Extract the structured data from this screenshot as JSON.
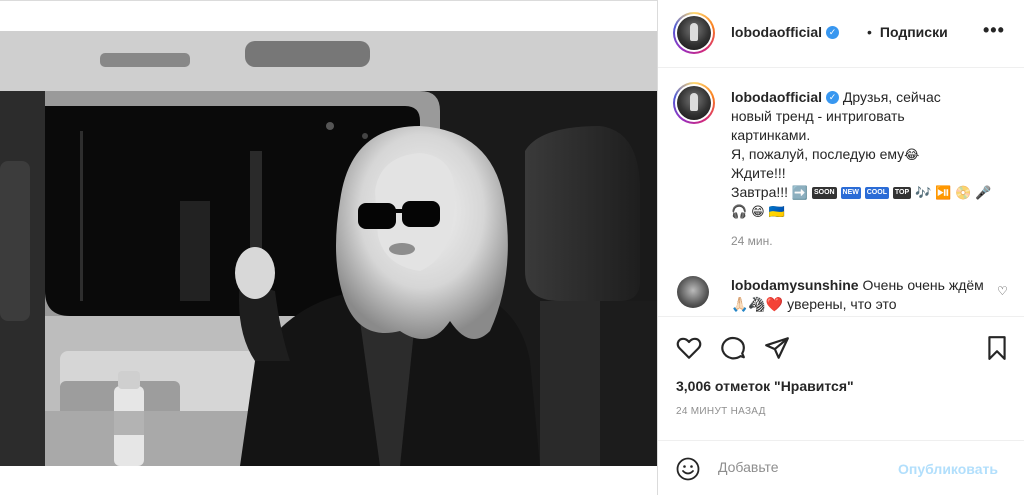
{
  "post": {
    "username": "lobodaofficial",
    "follow_label": "Подписки",
    "more_label": "•••",
    "separator": "•",
    "verified_mark": "✓"
  },
  "caption": {
    "username": "lobodaofficial",
    "line1": "Друзья, сейчас",
    "line2": "новый тренд - интриговать",
    "line3": "картинками.",
    "line4": "Я, пожалуй, последую ему",
    "line4_emoji": "😂",
    "line5": "Ждите!!!",
    "line6": "Завтра!!!",
    "line6_emojis": [
      "➡️",
      "SOON",
      "NEW",
      "COOL",
      "TOP",
      "🎶",
      "⏯️",
      "📀",
      "🎤"
    ],
    "line7_emojis": [
      "🎧",
      "😁",
      "🇺🇦"
    ],
    "time": "24 мин."
  },
  "comment": {
    "username": "lobodamysunshine",
    "text": "Очень очень ждём🙏🏻🦓❤️ уверены, что это",
    "heart": "♡"
  },
  "likes_text": "3,006 отметок \"Нравится\"",
  "posted_ago": "24 МИНУТ НАЗАД",
  "add_comment": {
    "placeholder": "Добавьте",
    "publish_label": "Опубликовать"
  },
  "icons": {
    "like": "heart-outline-icon",
    "comment": "speech-bubble-icon",
    "share": "paper-plane-icon",
    "save": "bookmark-icon",
    "emoji": "smiley-icon"
  },
  "colors": {
    "verified": "#3897f0",
    "publish_disabled": "#b2dffc",
    "secondary_text": "#8e8e8e",
    "border": "#dbdbdb"
  }
}
